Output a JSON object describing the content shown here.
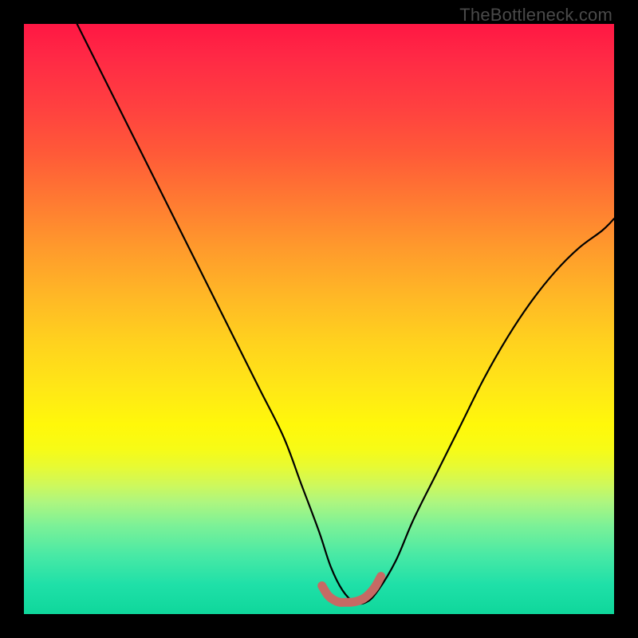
{
  "watermark": "TheBottleneck.com",
  "chart_data": {
    "type": "line",
    "title": "",
    "xlabel": "",
    "ylabel": "",
    "xlim": [
      0,
      100
    ],
    "ylim": [
      0,
      100
    ],
    "series": [
      {
        "name": "bottleneck-curve",
        "x": [
          9,
          12,
          16,
          20,
          24,
          28,
          32,
          36,
          40,
          44,
          47,
          50,
          52,
          54,
          56,
          58,
          60,
          63,
          66,
          70,
          74,
          78,
          82,
          86,
          90,
          94,
          98,
          100
        ],
        "y": [
          100,
          94,
          86,
          78,
          70,
          62,
          54,
          46,
          38,
          30,
          22,
          14,
          8,
          4,
          2,
          2,
          4,
          9,
          16,
          24,
          32,
          40,
          47,
          53,
          58,
          62,
          65,
          67
        ]
      },
      {
        "name": "optimal-zone-marker",
        "x": [
          50.5,
          51.5,
          52.5,
          53.5,
          54.5,
          55.5,
          56.5,
          57.5,
          58.5,
          59.5,
          60.5
        ],
        "y": [
          4.8,
          3.2,
          2.4,
          2.0,
          2.0,
          2.0,
          2.2,
          2.6,
          3.4,
          4.6,
          6.4
        ]
      }
    ],
    "colors": {
      "curve": "#000000",
      "marker": "#c66a64",
      "gradient_top": "#ff1744",
      "gradient_mid": "#ffe816",
      "gradient_bottom": "#0fd79b"
    }
  }
}
